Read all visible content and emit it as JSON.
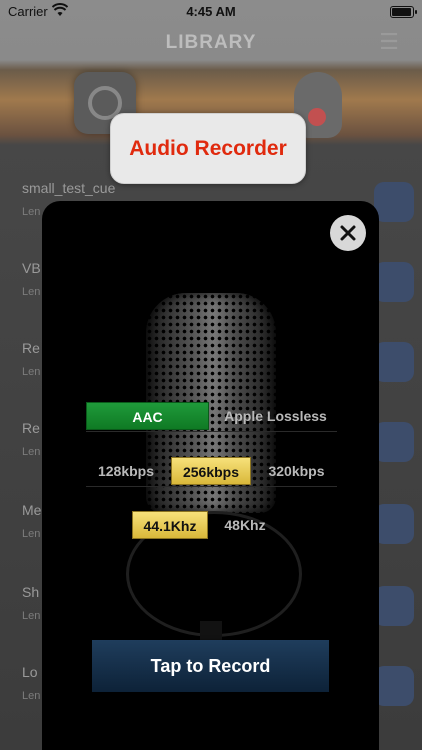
{
  "status_bar": {
    "carrier": "Carrier",
    "time": "4:45 AM"
  },
  "background": {
    "title": "LIBRARY",
    "rows": [
      {
        "title": "small_test_cue",
        "subtitle": "Len"
      },
      {
        "title": "VB",
        "subtitle": "Len"
      },
      {
        "title": "Re",
        "subtitle": "Len"
      },
      {
        "title": "Re",
        "subtitle": "Len"
      },
      {
        "title": "Me",
        "subtitle": "Len"
      },
      {
        "title": "Sh",
        "subtitle": "Len"
      },
      {
        "title": "Lo",
        "subtitle": "Len"
      }
    ]
  },
  "banner": {
    "title": "Audio Recorder"
  },
  "recorder": {
    "format_options": [
      "AAC",
      "Apple Lossless"
    ],
    "selected_format": "AAC",
    "bitrate_options": [
      "128kbps",
      "256kbps",
      "320kbps"
    ],
    "selected_bitrate": "256kbps",
    "sample_rate_options": [
      "44.1Khz",
      "48Khz"
    ],
    "selected_sample_rate": "44.1Khz",
    "record_label": "Tap to Record"
  },
  "colors": {
    "banner_text": "#e02a0e",
    "format_selected": "#1a8f34",
    "option_selected": "#f0d45c",
    "record_button": "#16304c"
  },
  "icons": {
    "close": "close-icon",
    "wifi": "wifi-icon",
    "battery": "battery-icon",
    "menu": "menu-icon"
  }
}
